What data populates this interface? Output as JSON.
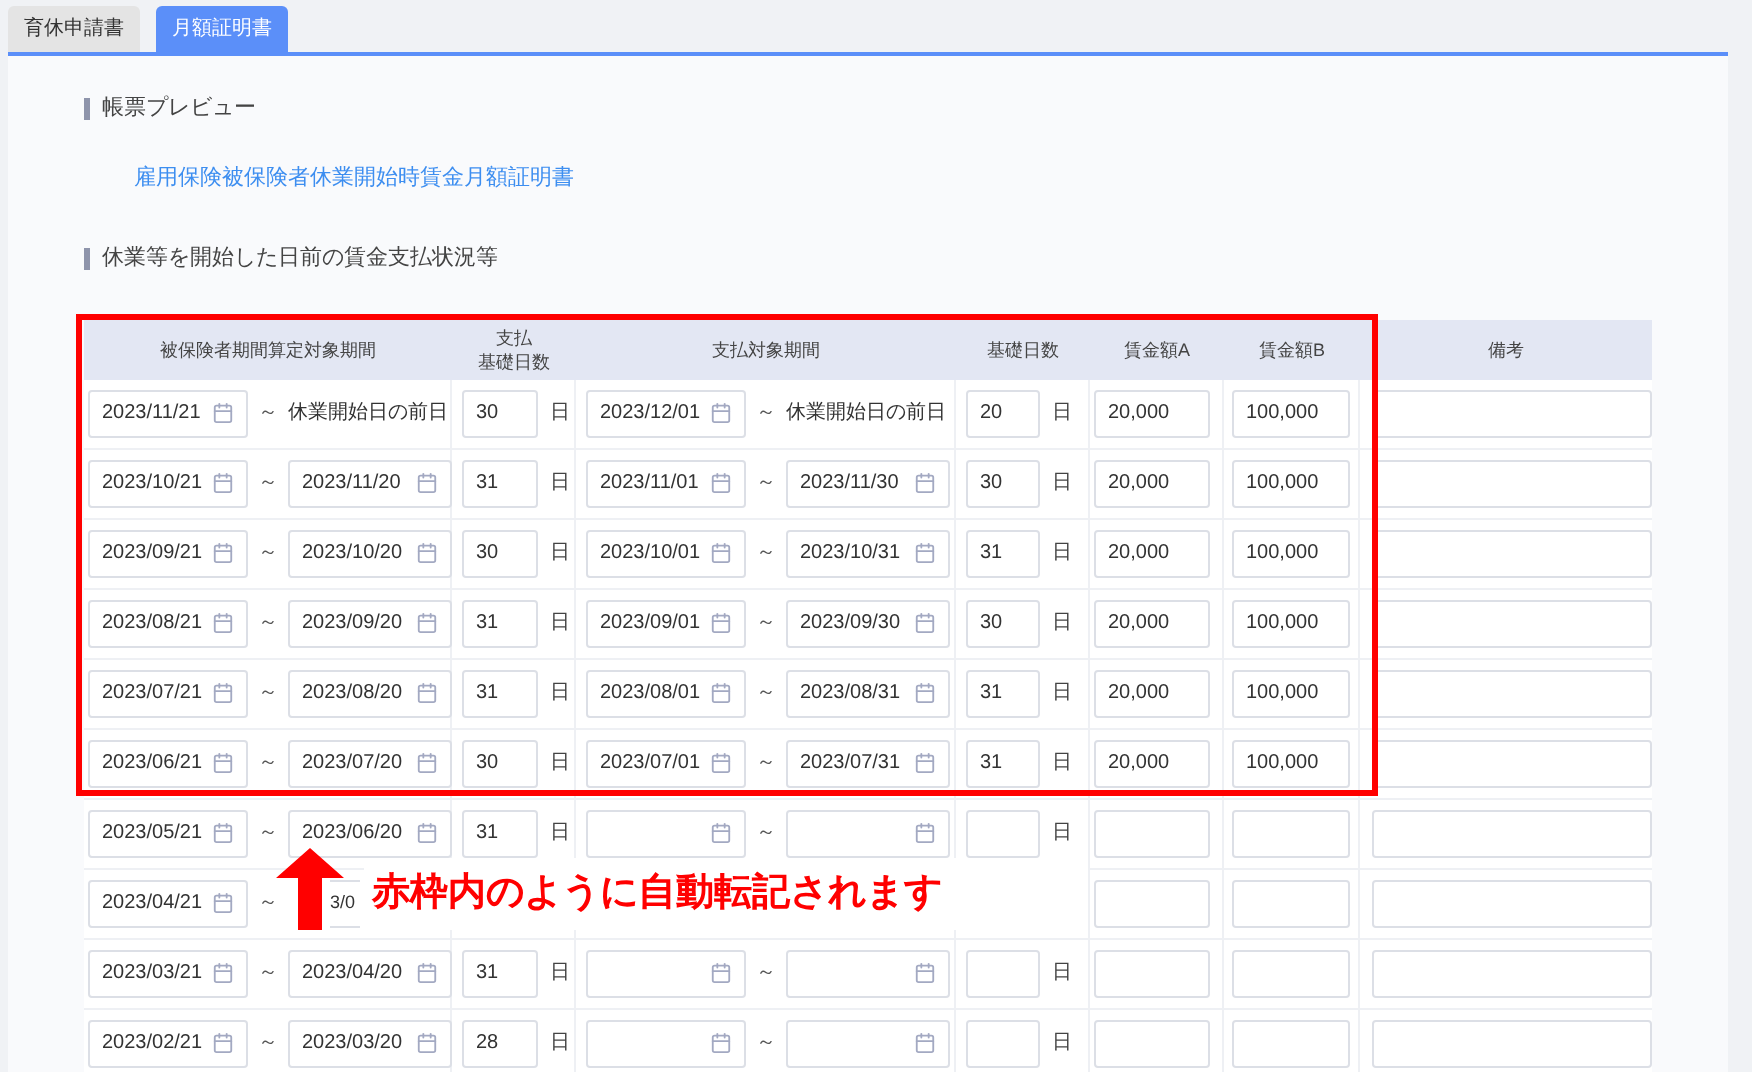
{
  "tabs": [
    {
      "label": "育休申請書",
      "selected": false
    },
    {
      "label": "月額証明書",
      "selected": true
    }
  ],
  "sections": [
    {
      "heading": "帳票プレビュー",
      "links": [
        "雇用保険被保険者休業開始時賃金月額証明書"
      ]
    },
    {
      "heading": "休業等を開始した日前の賃金支払状況等"
    }
  ],
  "table": {
    "columns": [
      [
        "被保険者期間算定対象期間"
      ],
      [
        "支払",
        "基礎日数"
      ],
      [
        "支払対象期間"
      ],
      [
        "基礎日数"
      ],
      [
        "賃金額A"
      ],
      [
        "賃金額B"
      ],
      [
        "備考"
      ]
    ],
    "rows": [
      {
        "from": "2023/11/21",
        "tilde": "～",
        "to": {
          "kind": "text",
          "value": "休業開始日の前日"
        },
        "days": "30",
        "days_unit": "日",
        "pay_from": "2023/12/01",
        "pay_tilde": "～",
        "pay_to": {
          "kind": "text",
          "value": "休業開始日の前日"
        },
        "basic_days": "20",
        "basic_unit": "日",
        "wage_a": "20,000",
        "wage_b": "100,000"
      },
      {
        "from": "2023/10/21",
        "tilde": "～",
        "to": {
          "kind": "date",
          "value": "2023/11/20"
        },
        "days": "31",
        "days_unit": "日",
        "pay_from": "2023/11/01",
        "pay_tilde": "～",
        "pay_to": {
          "kind": "date",
          "value": "2023/11/30"
        },
        "basic_days": "30",
        "basic_unit": "日",
        "wage_a": "20,000",
        "wage_b": "100,000"
      },
      {
        "from": "2023/09/21",
        "tilde": "～",
        "to": {
          "kind": "date",
          "value": "2023/10/20"
        },
        "days": "30",
        "days_unit": "日",
        "pay_from": "2023/10/01",
        "pay_tilde": "～",
        "pay_to": {
          "kind": "date",
          "value": "2023/10/31"
        },
        "basic_days": "31",
        "basic_unit": "日",
        "wage_a": "20,000",
        "wage_b": "100,000"
      },
      {
        "from": "2023/08/21",
        "tilde": "～",
        "to": {
          "kind": "date",
          "value": "2023/09/20"
        },
        "days": "31",
        "days_unit": "日",
        "pay_from": "2023/09/01",
        "pay_tilde": "～",
        "pay_to": {
          "kind": "date",
          "value": "2023/09/30"
        },
        "basic_days": "30",
        "basic_unit": "日",
        "wage_a": "20,000",
        "wage_b": "100,000"
      },
      {
        "from": "2023/07/21",
        "tilde": "～",
        "to": {
          "kind": "date",
          "value": "2023/08/20"
        },
        "days": "31",
        "days_unit": "日",
        "pay_from": "2023/08/01",
        "pay_tilde": "～",
        "pay_to": {
          "kind": "date",
          "value": "2023/08/31"
        },
        "basic_days": "31",
        "basic_unit": "日",
        "wage_a": "20,000",
        "wage_b": "100,000"
      },
      {
        "from": "2023/06/21",
        "tilde": "～",
        "to": {
          "kind": "date",
          "value": "2023/07/20"
        },
        "days": "30",
        "days_unit": "日",
        "pay_from": "2023/07/01",
        "pay_tilde": "～",
        "pay_to": {
          "kind": "date",
          "value": "2023/07/31"
        },
        "basic_days": "31",
        "basic_unit": "日",
        "wage_a": "20,000",
        "wage_b": "100,000"
      },
      {
        "from": "2023/05/21",
        "tilde": "～",
        "to": {
          "kind": "date",
          "value": "2023/06/20"
        },
        "days": "31",
        "days_unit": "日",
        "pay_tilde": "～",
        "pay_to": {
          "kind": "date"
        },
        "basic_unit": "日"
      },
      {
        "from": "2023/04/21",
        "tilde": "～",
        "to": {
          "kind": "partial",
          "value": "3/0"
        }
      },
      {
        "from": "2023/03/21",
        "tilde": "～",
        "to": {
          "kind": "date",
          "value": "2023/04/20"
        },
        "days": "31",
        "days_unit": "日",
        "pay_tilde": "～",
        "pay_to": {
          "kind": "date"
        },
        "basic_unit": "日"
      },
      {
        "from": "2023/02/21",
        "tilde": "～",
        "to": {
          "kind": "date",
          "value": "2023/03/20"
        },
        "days": "28",
        "days_unit": "日",
        "pay_tilde": "～",
        "pay_to": {
          "kind": "date"
        },
        "basic_unit": "日"
      }
    ]
  },
  "annotation": {
    "text": "赤枠内のように自動転記されます"
  }
}
